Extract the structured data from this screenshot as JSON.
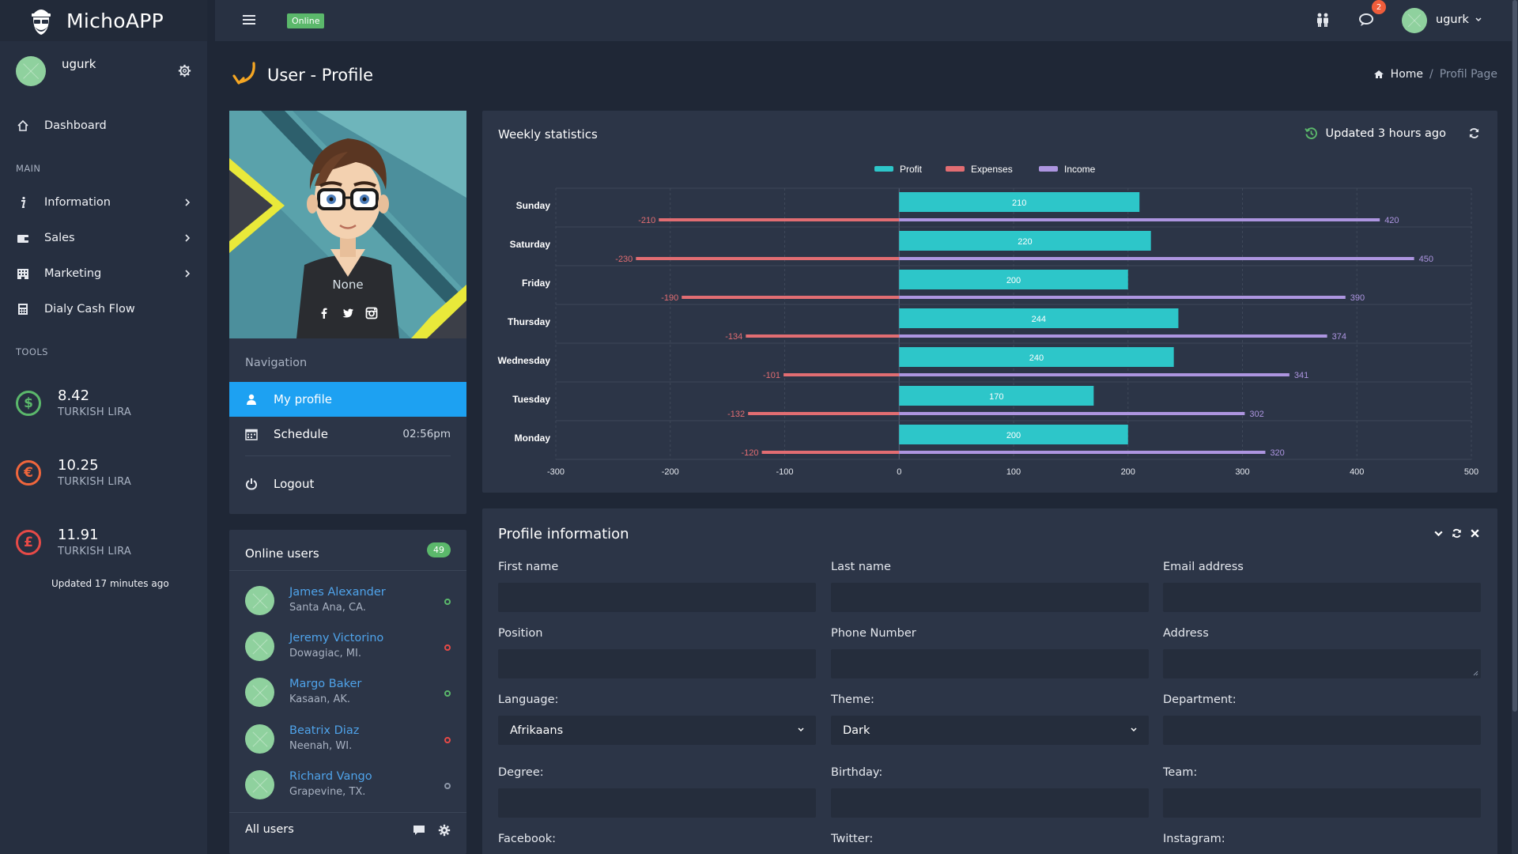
{
  "app": {
    "name": "MichoAPP",
    "status": "Online"
  },
  "sidebar": {
    "user": {
      "name": "ugurk"
    },
    "dashboard_label": "Dashboard",
    "main_label": "MAIN",
    "items": [
      {
        "label": "Information",
        "icon": "info-icon"
      },
      {
        "label": "Sales",
        "icon": "wallet-icon"
      },
      {
        "label": "Marketing",
        "icon": "building-icon"
      },
      {
        "label": "Dialy Cash Flow",
        "icon": "calculator-icon"
      }
    ],
    "tools_label": "TOOLS",
    "rates": [
      {
        "value": "8.42",
        "unit": "TURKISH LIRA",
        "symbol": "$",
        "color": "#5bb86b"
      },
      {
        "value": "10.25",
        "unit": "TURKISH LIRA",
        "symbol": "€",
        "color": "#f0663c"
      },
      {
        "value": "11.91",
        "unit": "TURKISH LIRA",
        "symbol": "£",
        "color": "#e64a47"
      }
    ],
    "updated": "Updated 17 minutes ago"
  },
  "topbar": {
    "online_badge": "Online",
    "notifications": "2",
    "user": "ugurk"
  },
  "page": {
    "title": "User - Profile",
    "breadcrumb": {
      "home": "Home",
      "separator": "/",
      "current": "Profil Page"
    }
  },
  "profile_card": {
    "name": "None",
    "navigation_label": "Navigation",
    "nav": [
      {
        "label": "My profile",
        "icon": "user-icon",
        "active": true
      },
      {
        "label": "Schedule",
        "icon": "calendar-icon",
        "time": "02:56pm"
      },
      {
        "label": "Logout",
        "icon": "power-icon"
      }
    ]
  },
  "online_users": {
    "title": "Online users",
    "count": "49",
    "users": [
      {
        "name": "James Alexander",
        "location": "Santa Ana, CA.",
        "status_color": "#5bb86b"
      },
      {
        "name": "Jeremy Victorino",
        "location": "Dowagiac, MI.",
        "status_color": "#e64a47"
      },
      {
        "name": "Margo Baker",
        "location": "Kasaan, AK.",
        "status_color": "#5bb86b"
      },
      {
        "name": "Beatrix Diaz",
        "location": "Neenah, WI.",
        "status_color": "#e64a47"
      },
      {
        "name": "Richard Vango",
        "location": "Grapevine, TX.",
        "status_color": "#8d97a8"
      }
    ],
    "footer": "All users"
  },
  "weekly_stats": {
    "title": "Weekly statistics",
    "updated": "Updated 3 hours ago"
  },
  "chart_data": {
    "type": "bar",
    "orientation": "horizontal",
    "categories": [
      "Sunday",
      "Saturday",
      "Friday",
      "Thursday",
      "Wednesday",
      "Tuesday",
      "Monday"
    ],
    "series": [
      {
        "name": "Profit",
        "color": "#2dc6c9",
        "values": [
          210,
          220,
          200,
          244,
          240,
          170,
          200
        ]
      },
      {
        "name": "Expenses",
        "color": "#e26d72",
        "values": [
          -210,
          -230,
          -190,
          -134,
          -101,
          -132,
          -120
        ]
      },
      {
        "name": "Income",
        "color": "#ad95e0",
        "values": [
          420,
          450,
          390,
          374,
          341,
          302,
          320
        ]
      }
    ],
    "xlim": [
      -300,
      500
    ],
    "xticks": [
      -300,
      -200,
      -100,
      0,
      100,
      200,
      300,
      400,
      500
    ],
    "legend": "top-center",
    "grid": true
  },
  "profile_info": {
    "title": "Profile information",
    "fields": {
      "first_name": "First name",
      "last_name": "Last name",
      "email": "Email address",
      "position": "Position",
      "phone": "Phone Number",
      "address": "Address",
      "language": "Language:",
      "theme": "Theme:",
      "department": "Department:",
      "degree": "Degree:",
      "birthday": "Birthday:",
      "team": "Team:",
      "facebook": "Facebook:",
      "twitter": "Twitter:",
      "instagram": "Instagram:"
    },
    "language_value": "Afrikaans",
    "theme_value": "Dark"
  }
}
